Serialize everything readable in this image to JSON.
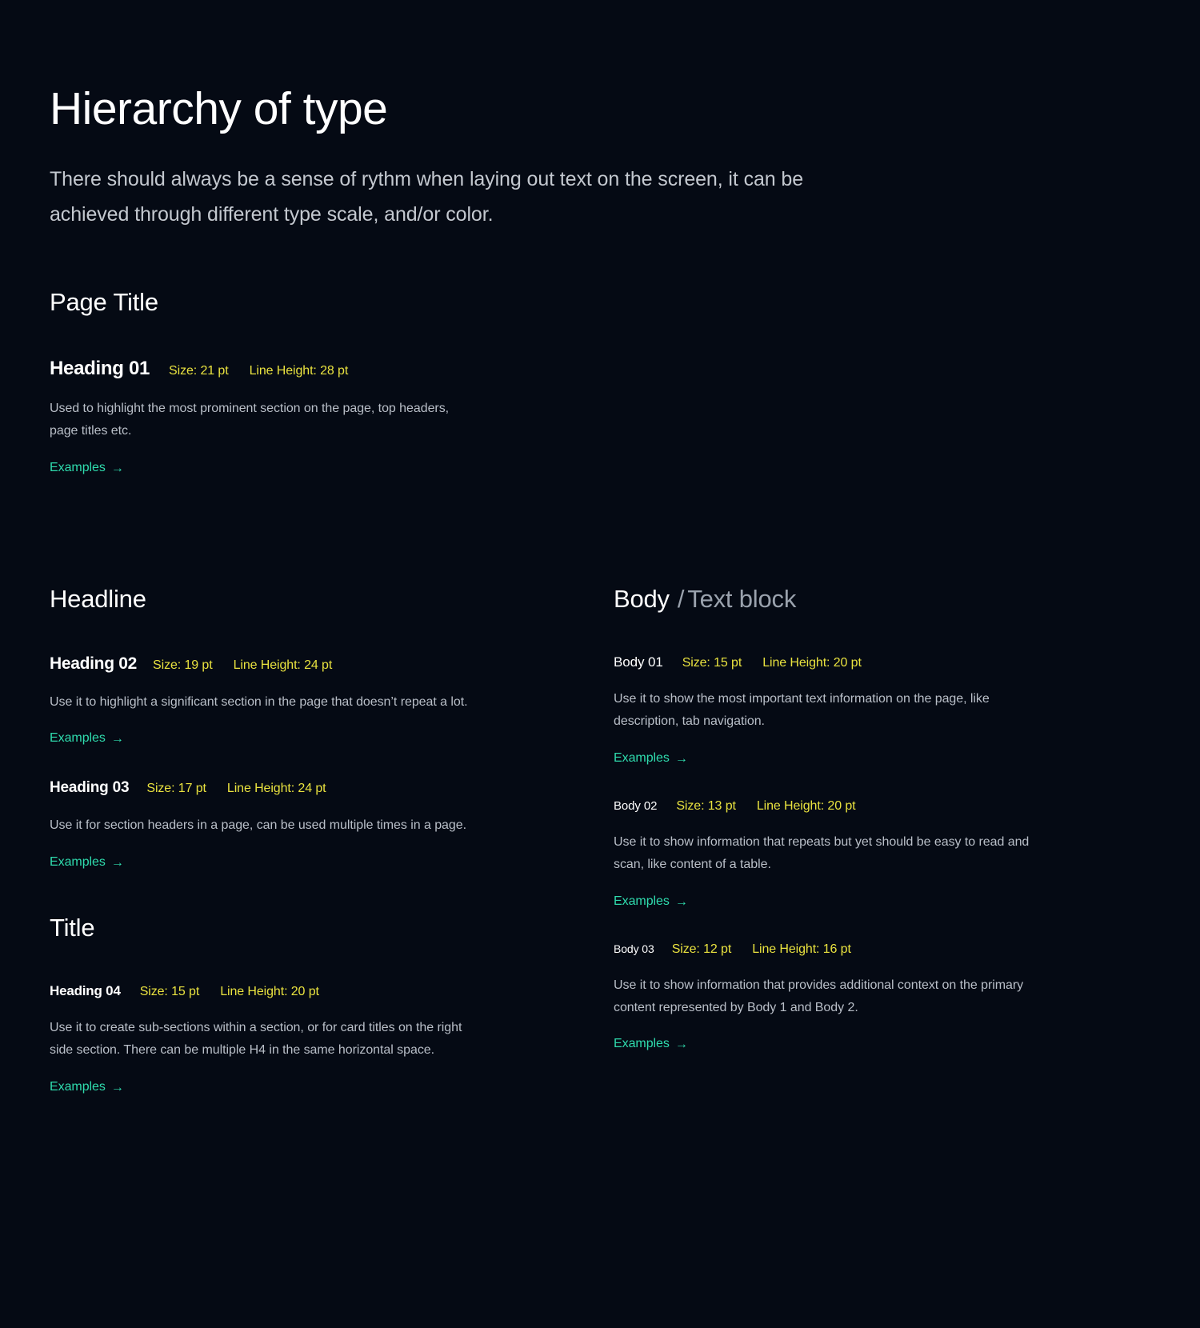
{
  "header": {
    "title": "Hierarchy of type",
    "subtitle": "There should always be a sense of rythm when laying out text on the screen, it can be achieved through different type scale, and/or color."
  },
  "colors": {
    "background": "#050a14",
    "title_text": "#ffffff",
    "body_text": "#b9bfc8",
    "metric_yellow": "#e9e23f",
    "link_teal": "#2fdcae",
    "muted_label": "#9aa2ad"
  },
  "link_label": "Examples",
  "link_icon": "arrow-right-icon",
  "arrow_glyph": "→",
  "sections": {
    "page_title": {
      "category": "Page Title",
      "entries": [
        {
          "name": "Heading 01",
          "size": "Size: 21 pt",
          "line_height": "Line Height: 28 pt",
          "description": "Used to highlight the most prominent section on the page, top headers, page titles etc.",
          "link": "Examples"
        }
      ]
    },
    "headline": {
      "category": "Headline",
      "entries": [
        {
          "name": "Heading 02",
          "size": "Size: 19 pt",
          "line_height": "Line Height: 24 pt",
          "description": "Use it to highlight a significant section in the page that doesn’t repeat a lot.",
          "link": "Examples"
        },
        {
          "name": "Heading 03",
          "size": "Size: 17 pt",
          "line_height": "Line Height: 24 pt",
          "description": "Use it for section headers in a page, can be used multiple times in a page.",
          "link": "Examples"
        }
      ]
    },
    "title": {
      "category": "Title",
      "entries": [
        {
          "name": "Heading 04",
          "size": "Size: 15 pt",
          "line_height": "Line Height: 20 pt",
          "description": "Use it to create sub-sections within a section, or for card titles on the right side section. There can be multiple H4 in the same horizontal space.",
          "link": "Examples"
        }
      ]
    },
    "body": {
      "category": "Body",
      "category_suffix": "Text block",
      "category_separator": "/",
      "entries": [
        {
          "name": "Body 01",
          "size": "Size: 15 pt",
          "line_height": "Line Height: 20 pt",
          "description": "Use it to show the most important text information on the page, like description, tab navigation.",
          "link": "Examples"
        },
        {
          "name": "Body 02",
          "size": "Size: 13 pt",
          "line_height": "Line Height: 20 pt",
          "description": "Use it to show information that repeats but yet should be easy to read and scan, like content of a table.",
          "link": "Examples"
        },
        {
          "name": "Body 03",
          "size": "Size: 12 pt",
          "line_height": "Line Height: 16 pt",
          "description": "Use it to show information that provides additional context on the primary content represented by Body 1 and Body 2.",
          "link": "Examples"
        }
      ]
    }
  }
}
